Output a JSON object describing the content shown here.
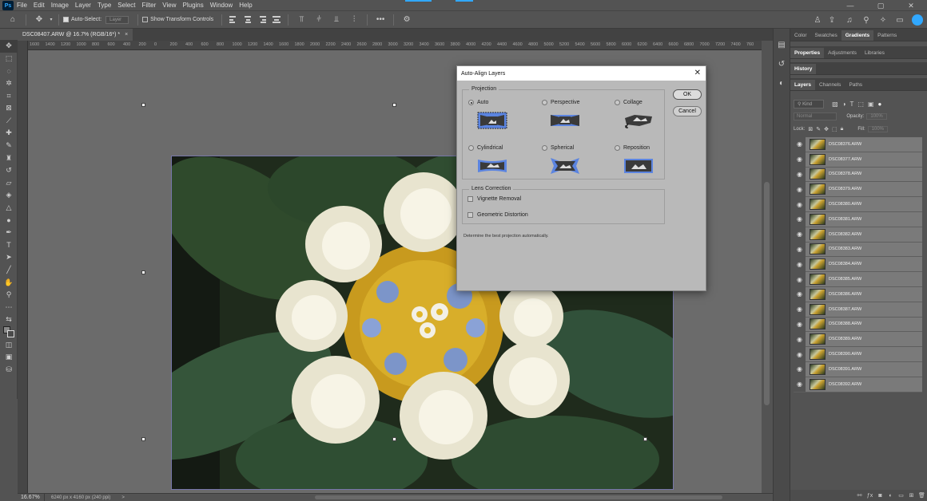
{
  "app": {
    "logo": "Ps"
  },
  "menu": [
    "File",
    "Edit",
    "Image",
    "Layer",
    "Type",
    "Select",
    "Filter",
    "View",
    "Plugins",
    "Window",
    "Help"
  ],
  "window_controls": {
    "minimize": "—",
    "maximize": "▢",
    "close": "✕"
  },
  "options_bar": {
    "auto_select_label": "Auto-Select:",
    "auto_select_target": "Layer",
    "transform_controls_label": "Show Transform Controls",
    "more": "•••"
  },
  "document": {
    "tab_title": "DSC08407.ARW @ 16.7% (RGB/16*) *",
    "close_glyph": "×"
  },
  "ruler_ticks": [
    "1600",
    "1400",
    "1200",
    "1000",
    "800",
    "600",
    "400",
    "200",
    "0",
    "200",
    "400",
    "600",
    "800",
    "1000",
    "1200",
    "1400",
    "1600",
    "1800",
    "2000",
    "2200",
    "2400",
    "2600",
    "2800",
    "3000",
    "3200",
    "3400",
    "3600",
    "3800",
    "4000",
    "4200",
    "4400",
    "4600",
    "4800",
    "5000",
    "5200",
    "5400",
    "5600",
    "5800",
    "6000",
    "6200",
    "6400",
    "6600",
    "6800",
    "7000",
    "7200",
    "7400",
    "760"
  ],
  "status_bar": {
    "zoom": "16.67%",
    "doc_info": "6240 px x 4160 px (240 ppi)",
    "arrow": ">"
  },
  "panels": {
    "top_tabs": [
      "Color",
      "Swatches",
      "Gradients",
      "Patterns"
    ],
    "top_active": "Gradients",
    "mid_tabs": [
      "Properties",
      "Adjustments",
      "Libraries"
    ],
    "mid_active": "Properties",
    "history_tab": "History",
    "layer_tabs": [
      "Layers",
      "Channels",
      "Paths"
    ],
    "layer_active": "Layers",
    "filter_kind": "Kind",
    "blend_mode": "Normal",
    "opacity_label": "Opacity:",
    "opacity_value": "100%",
    "lock_label": "Lock:",
    "fill_label": "Fill:",
    "fill_value": "100%"
  },
  "layers": [
    "DSC08376.ARW",
    "DSC08377.ARW",
    "DSC08378.ARW",
    "DSC08379.ARW",
    "DSC08380.ARW",
    "DSC08381.ARW",
    "DSC08382.ARW",
    "DSC08383.ARW",
    "DSC08384.ARW",
    "DSC08385.ARW",
    "DSC08386.ARW",
    "DSC08387.ARW",
    "DSC08388.ARW",
    "DSC08389.ARW",
    "DSC08390.ARW",
    "DSC08391.ARW",
    "DSC08392.ARW"
  ],
  "dialog": {
    "title": "Auto-Align Layers",
    "projection_title": "Projection",
    "options": [
      {
        "label": "Auto",
        "selected": true
      },
      {
        "label": "Perspective",
        "selected": false
      },
      {
        "label": "Collage",
        "selected": false
      },
      {
        "label": "Cylindrical",
        "selected": false
      },
      {
        "label": "Spherical",
        "selected": false
      },
      {
        "label": "Reposition",
        "selected": false
      }
    ],
    "lens_title": "Lens Correction",
    "vignette_label": "Vignette Removal",
    "geometric_label": "Geometric Distortion",
    "hint": "Determine the best projection automatically.",
    "ok_label": "OK",
    "cancel_label": "Cancel"
  },
  "colors": {
    "accent": "#31a8ff",
    "projection_blue": "#5b84e0",
    "projection_dark": "#3a3a3a"
  }
}
